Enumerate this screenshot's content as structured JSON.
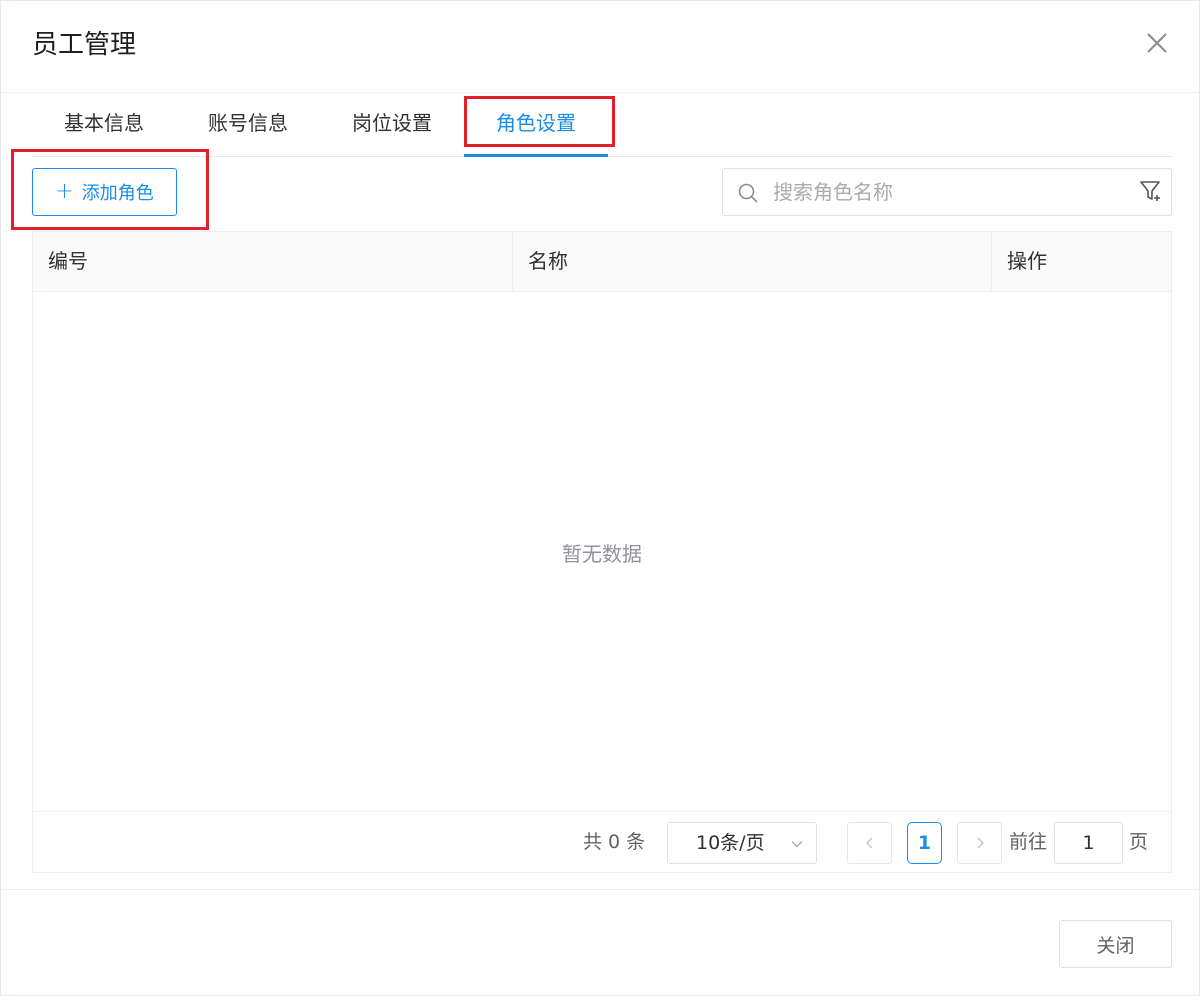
{
  "dialog": {
    "title": "员工管理",
    "close_icon": "close-icon"
  },
  "tabs": [
    {
      "label": "基本信息",
      "active": false
    },
    {
      "label": "账号信息",
      "active": false
    },
    {
      "label": "岗位设置",
      "active": false
    },
    {
      "label": "角色设置",
      "active": true
    }
  ],
  "toolbar": {
    "add_label": "添加角色",
    "search_placeholder": "搜索角色名称",
    "search_value": ""
  },
  "table": {
    "columns": [
      "编号",
      "名称",
      "操作"
    ],
    "rows": [],
    "empty_text": "暂无数据"
  },
  "pagination": {
    "total_text": "共 0 条",
    "page_size": "10条/页",
    "current_page": "1",
    "goto_label": "前往",
    "goto_value": "1",
    "page_unit": "页"
  },
  "footer": {
    "close_label": "关闭"
  },
  "colors": {
    "accent": "#1a8ee6",
    "highlight": "#e0202b"
  }
}
